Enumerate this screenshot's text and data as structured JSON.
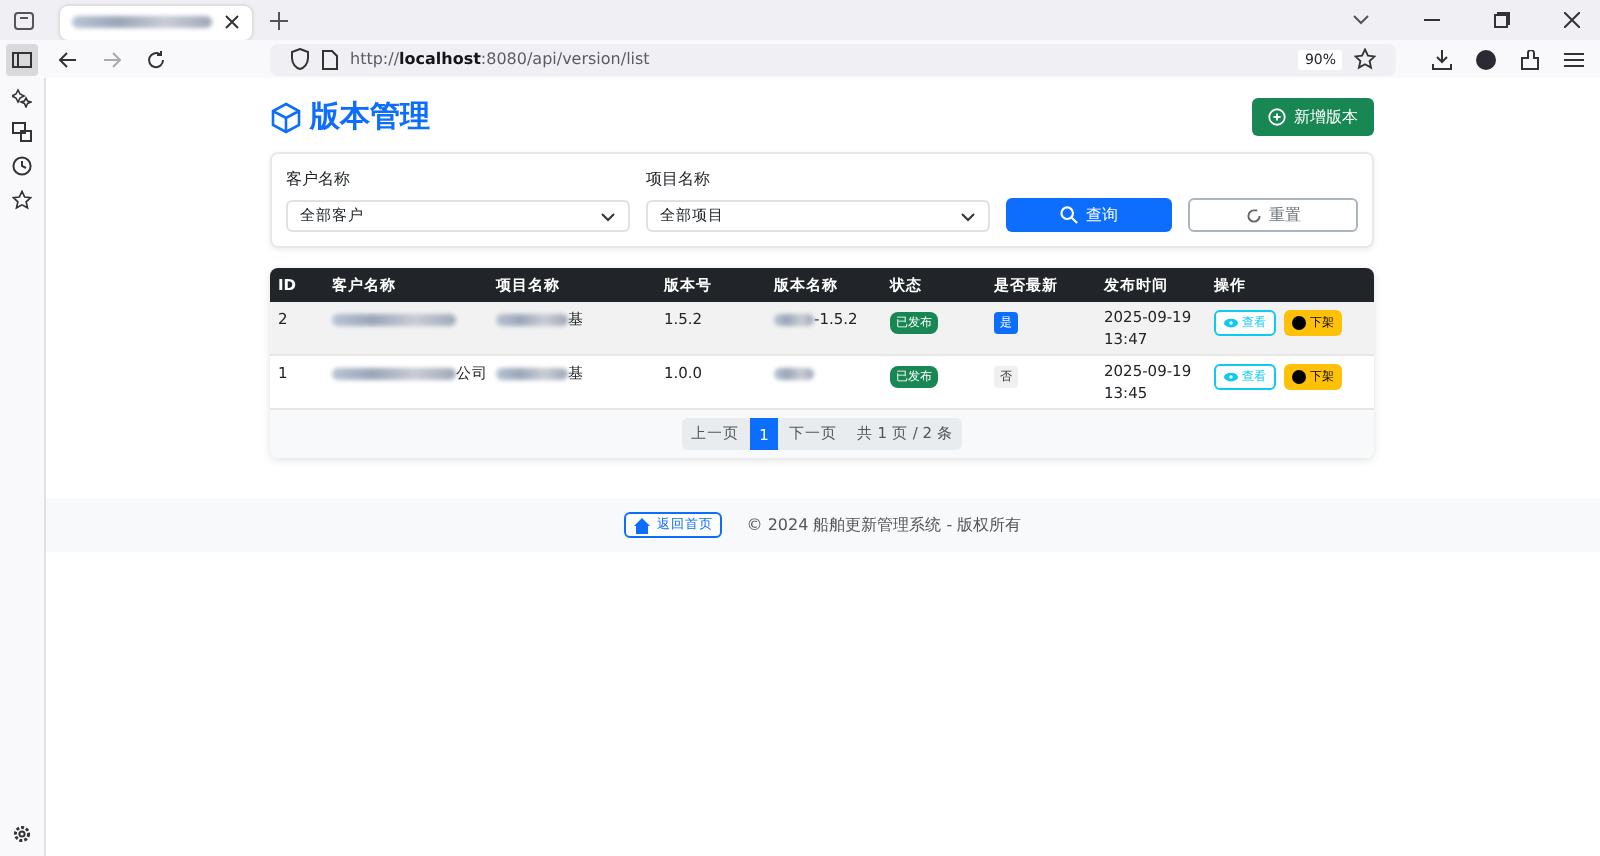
{
  "browser": {
    "url": "http://**localhost**:8080/api/version/list",
    "zoom": "90%"
  },
  "page": {
    "title": "版本管理",
    "add_button": "新增版本",
    "filters": [
      {
        "label": "客户名称",
        "value": "全部客户"
      },
      {
        "label": "项目名称",
        "value": "全部项目"
      }
    ],
    "search_button": "查询",
    "reset_button": "重置",
    "table": {
      "columns": [
        "ID",
        "客户名称",
        "项目名称",
        "版本号",
        "版本名称",
        "状态",
        "是否最新",
        "发布时间",
        "操作"
      ],
      "rows": [
        {
          "id": "2",
          "customer": "",
          "project": "基",
          "version": "1.5.2",
          "version_name": "-1.5.2",
          "status": "已发布",
          "latest": {
            "label": "是",
            "highlight": true
          },
          "date": "2025-09-19",
          "time": "13:47",
          "actions": [
            "查看",
            "下架"
          ]
        },
        {
          "id": "1",
          "customer": "公司",
          "project": "基",
          "version": "1.0.0",
          "version_name": "",
          "status": "已发布",
          "latest": {
            "label": "否",
            "highlight": false
          },
          "date": "2025-09-19",
          "time": "13:45",
          "actions": [
            "查看",
            "下架"
          ]
        }
      ]
    },
    "pagination": {
      "prev": "上一页",
      "pages": [
        {
          "label": "1",
          "selected": true
        }
      ],
      "next": "下一页",
      "summary": "共 1 页 / 2 条"
    }
  },
  "footer": {
    "home_button": "返回首页",
    "copyright": "© 2024 船舶更新管理系统 - 版权所有"
  }
}
